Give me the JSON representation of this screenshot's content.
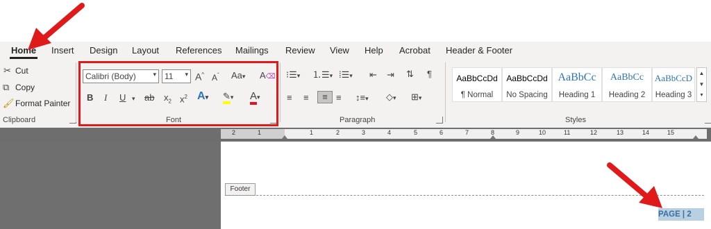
{
  "tabs": [
    {
      "label": "Home",
      "active": true
    },
    {
      "label": "Insert"
    },
    {
      "label": "Design"
    },
    {
      "label": "Layout"
    },
    {
      "label": "References"
    },
    {
      "label": "Mailings"
    },
    {
      "label": "Review"
    },
    {
      "label": "View"
    },
    {
      "label": "Help"
    },
    {
      "label": "Acrobat"
    },
    {
      "label": "Header & Footer"
    }
  ],
  "clipboard": {
    "label": "Clipboard",
    "cut": "Cut",
    "copy": "Copy",
    "format_painter": "Format Painter"
  },
  "font": {
    "label": "Font",
    "family": "Calibri (Body)",
    "size": "11",
    "grow": "A",
    "shrink": "A",
    "change_case": "Aa",
    "bold": "B",
    "italic": "I",
    "underline": "U",
    "strikethrough": "ab",
    "subscript": "x",
    "superscript": "x",
    "font_color": "A",
    "text_effects": "A"
  },
  "paragraph": {
    "label": "Paragraph"
  },
  "styles": {
    "label": "Styles",
    "items": [
      {
        "preview": "AaBbCcDd",
        "name": "¶ Normal"
      },
      {
        "preview": "AaBbCcDd",
        "name": "No Spacing"
      },
      {
        "preview": "AaBbCc",
        "name": "Heading 1"
      },
      {
        "preview": "AaBbCc",
        "name": "Heading 2"
      },
      {
        "preview": "AaBbCcD",
        "name": "Heading 3"
      }
    ]
  },
  "ruler": {
    "ticks": [
      "2",
      "1",
      "1",
      "2",
      "3",
      "4",
      "5",
      "6",
      "7",
      "8",
      "9",
      "10",
      "11",
      "12",
      "13",
      "14",
      "15"
    ]
  },
  "document": {
    "footer_tag": "Footer",
    "page_field": "PAGE | 2"
  },
  "colors": {
    "annotation_red": "#e01a1a",
    "heading_blue": "#2e74b5",
    "ribbon_bg": "#f3f2f1"
  }
}
